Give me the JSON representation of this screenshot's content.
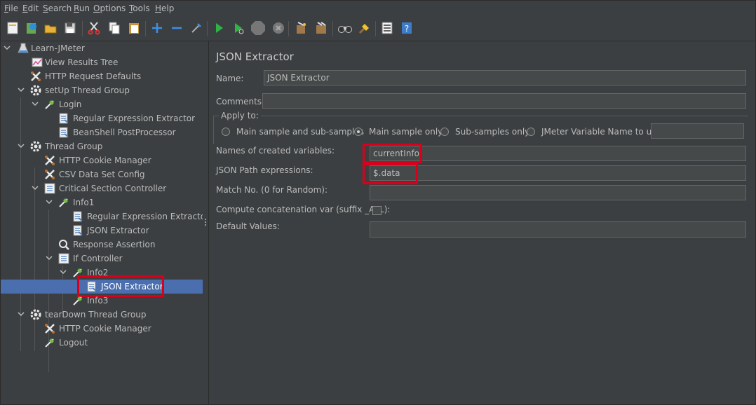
{
  "menu": [
    {
      "label": "File",
      "hotkey": "F"
    },
    {
      "label": "Edit",
      "hotkey": "E"
    },
    {
      "label": "Search",
      "hotkey": "S"
    },
    {
      "label": "Run",
      "hotkey": "R"
    },
    {
      "label": "Options",
      "hotkey": "O"
    },
    {
      "label": "Tools",
      "hotkey": "T"
    },
    {
      "label": "Help",
      "hotkey": "H"
    }
  ],
  "toolbar": {
    "icons": [
      "new-icon",
      "templates-icon",
      "open-icon",
      "save-icon",
      "cut-icon",
      "copy-icon",
      "paste-icon",
      "expand-icon",
      "collapse-icon",
      "toggle-icon",
      "start-icon",
      "start-no-pauses-icon",
      "stop-icon",
      "shutdown-icon",
      "clear-icon",
      "clear-all-icon",
      "search-icon",
      "reset-search-icon",
      "function-helper-icon",
      "help-icon"
    ]
  },
  "tree": {
    "nodes": [
      {
        "label": "Learn-JMeter",
        "icon": "test-plan-icon",
        "expanded": true
      },
      {
        "label": "View Results Tree",
        "icon": "listener-icon"
      },
      {
        "label": "HTTP Request Defaults",
        "icon": "config-icon"
      },
      {
        "label": "setUp Thread Group",
        "icon": "thread-group-icon",
        "expanded": true
      },
      {
        "label": "Login",
        "icon": "sampler-icon",
        "expanded": true
      },
      {
        "label": "Regular Expression Extractor",
        "icon": "post-processor-icon"
      },
      {
        "label": "BeanShell PostProcessor",
        "icon": "post-processor-icon"
      },
      {
        "label": "Thread Group",
        "icon": "thread-group-icon",
        "expanded": true
      },
      {
        "label": "HTTP Cookie Manager",
        "icon": "config-icon"
      },
      {
        "label": "CSV Data Set Config",
        "icon": "config-icon"
      },
      {
        "label": "Critical Section Controller",
        "icon": "controller-icon",
        "expanded": true
      },
      {
        "label": "Info1",
        "icon": "sampler-icon",
        "expanded": true
      },
      {
        "label": "Regular Expression Extractor",
        "icon": "post-processor-icon"
      },
      {
        "label": "JSON Extractor",
        "icon": "post-processor-icon"
      },
      {
        "label": "Response Assertion",
        "icon": "assertion-icon"
      },
      {
        "label": "If Controller",
        "icon": "controller-icon",
        "expanded": true
      },
      {
        "label": "Info2",
        "icon": "sampler-icon",
        "expanded": true
      },
      {
        "label": "JSON Extractor",
        "icon": "post-processor-icon",
        "selected": true
      },
      {
        "label": "Info3",
        "icon": "sampler-icon"
      },
      {
        "label": "tearDown Thread Group",
        "icon": "thread-group-icon",
        "expanded": true
      },
      {
        "label": "HTTP Cookie Manager",
        "icon": "config-icon"
      },
      {
        "label": "Logout",
        "icon": "sampler-icon"
      }
    ]
  },
  "panel": {
    "title": "JSON Extractor",
    "name_label": "Name:",
    "name_value": "JSON Extractor",
    "comments_label": "Comments:",
    "comments_value": "",
    "apply_to_label": "Apply to:",
    "apply_options": [
      {
        "label": "Main sample and sub-samples",
        "selected": false
      },
      {
        "label": "Main sample only",
        "selected": true
      },
      {
        "label": "Sub-samples only",
        "selected": false
      },
      {
        "label": "JMeter Variable Name to use",
        "selected": false
      }
    ],
    "jmeter_var_value": "",
    "names_label": "Names of created variables:",
    "names_value": "currentInfo",
    "paths_label": "JSON Path expressions:",
    "paths_value": "$.data",
    "match_label": "Match No. (0 for Random):",
    "match_value": "",
    "concat_label": "Compute concatenation var (suffix _ALL):",
    "concat_checked": false,
    "default_label": "Default Values:",
    "default_value": ""
  },
  "colors": {
    "background": "#3c3f41",
    "selection": "#4b6eaf",
    "highlight": "#d9001b"
  }
}
